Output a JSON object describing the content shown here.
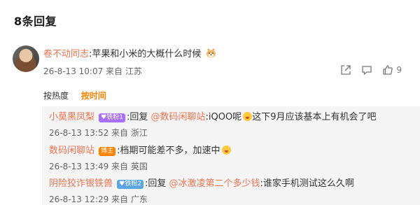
{
  "header": {
    "title": "8条回复"
  },
  "main_comment": {
    "username": "卷不动同志",
    "colon": ":",
    "text": "苹果和小米的大概什么时候",
    "emoji_icon": "shiba-dog-icon",
    "meta": "26-8-13 10:07 来自 江苏",
    "like_count": "9"
  },
  "sort": {
    "hot": "按热度",
    "time": "按时间"
  },
  "replies": [
    {
      "username": "小莫黑凤梨",
      "badge": "铁粉1",
      "badge_color": "#a970ff",
      "reply_prefix": ":回复",
      "mention": "@数码闲聊站",
      "text_before_emoji": ":iQOO呢",
      "text_after_emoji": "这下9月应该基本上有机会了吧",
      "meta": "26-8-13 13:52 来自 浙江"
    },
    {
      "username": "数码闲聊站",
      "badge": "博主",
      "badge_color": "#ff8200",
      "text": ":档期可能差不多，加速中",
      "meta": "26-8-13 13:49 来自 英国"
    },
    {
      "username": "阴险狡诈银铁兽",
      "badge": "铁粉2",
      "badge_color": "#5aa5e6",
      "reply_prefix": ":回复",
      "mention": "@冰激凌第二个多少钱",
      "text": ":谁家手机测试这么久啊",
      "meta": "26-8-13 12:29 来自 广东"
    }
  ]
}
